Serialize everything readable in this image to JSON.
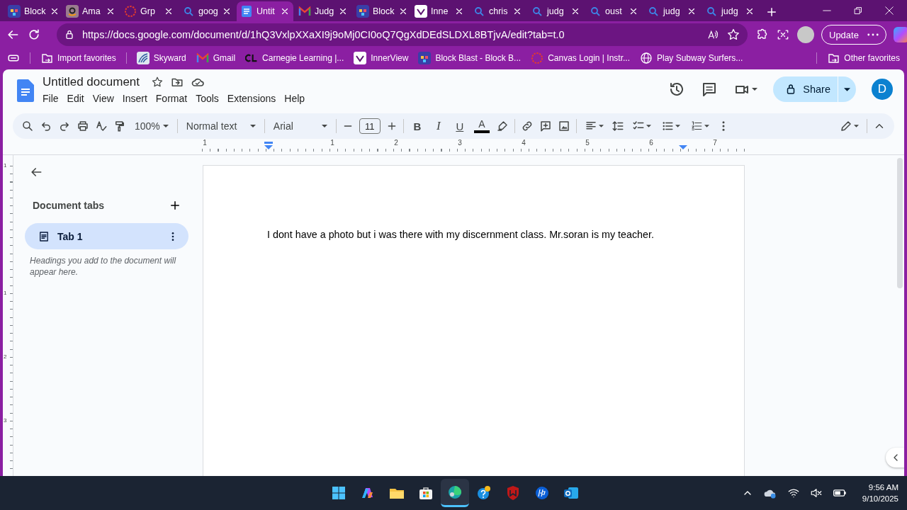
{
  "browser": {
    "tabs": [
      {
        "title": "Block",
        "kind": "game",
        "selected": false
      },
      {
        "title": "Ama",
        "kind": "amazon",
        "selected": false
      },
      {
        "title": "Grp",
        "kind": "canvas",
        "selected": false
      },
      {
        "title": "goog",
        "kind": "search",
        "selected": false
      },
      {
        "title": "Untit",
        "kind": "docs",
        "selected": true
      },
      {
        "title": "Judg",
        "kind": "gmail",
        "selected": false
      },
      {
        "title": "Block",
        "kind": "game",
        "selected": false
      },
      {
        "title": "Inne",
        "kind": "innerview",
        "selected": false
      },
      {
        "title": "chris",
        "kind": "search",
        "selected": false
      },
      {
        "title": "judg",
        "kind": "search",
        "selected": false
      },
      {
        "title": "oust",
        "kind": "search",
        "selected": false
      },
      {
        "title": "judg",
        "kind": "search",
        "selected": false
      },
      {
        "title": "judg",
        "kind": "search",
        "selected": false
      }
    ],
    "address": "https://docs.google.com/document/d/1hQ3VxlpXXaXI9j9oMj0CI0oQ7QgXdDEdSLDXL8BTjvA/edit?tab=t.0",
    "update_button": "Update",
    "bookmarks": [
      {
        "label": "Import favorites",
        "kind": "import"
      },
      {
        "label": "Skyward",
        "kind": "skyward"
      },
      {
        "label": "Gmail",
        "kind": "gmail"
      },
      {
        "label": "Carnegie Learning |...",
        "kind": "cl"
      },
      {
        "label": "InnerView",
        "kind": "innerview"
      },
      {
        "label": "Block Blast - Block B...",
        "kind": "game"
      },
      {
        "label": "Canvas Login | Instr...",
        "kind": "canvas"
      },
      {
        "label": "Play Subway Surfers...",
        "kind": "globe"
      }
    ],
    "other_favorites": "Other favorites"
  },
  "docs": {
    "title": "Untitled document",
    "menu": [
      "File",
      "Edit",
      "View",
      "Insert",
      "Format",
      "Tools",
      "Extensions",
      "Help"
    ],
    "share_button": "Share",
    "avatar": "D",
    "toolbar": {
      "zoom": "100%",
      "style": "Normal text",
      "font": "Arial",
      "font_size": "11",
      "bold": "B",
      "italic": "I",
      "underline": "U",
      "text_color": "A"
    },
    "ruler": [
      "1",
      "1",
      "2",
      "3",
      "4",
      "5",
      "6",
      "7"
    ],
    "vertical_ruler": [
      "1",
      "1",
      "2",
      "3"
    ],
    "sidebar": {
      "heading": "Document tabs",
      "tabs": [
        {
          "label": "Tab 1",
          "selected": true
        }
      ],
      "hint": "Headings you add to the document will appear here."
    },
    "body": "I dont have a photo but i was there with my discernment class. Mr.soran is my teacher."
  },
  "taskbar": {
    "apps": [
      {
        "kind": "start",
        "selected": false
      },
      {
        "kind": "copilot",
        "selected": false
      },
      {
        "kind": "folder",
        "selected": false
      },
      {
        "kind": "store",
        "selected": false
      },
      {
        "kind": "edge",
        "selected": true
      },
      {
        "kind": "help",
        "selected": false
      },
      {
        "kind": "shield",
        "selected": false
      },
      {
        "kind": "hp",
        "selected": false
      },
      {
        "kind": "outlook",
        "selected": false
      }
    ],
    "time": "9:56 AM",
    "date": "9/10/2025"
  }
}
